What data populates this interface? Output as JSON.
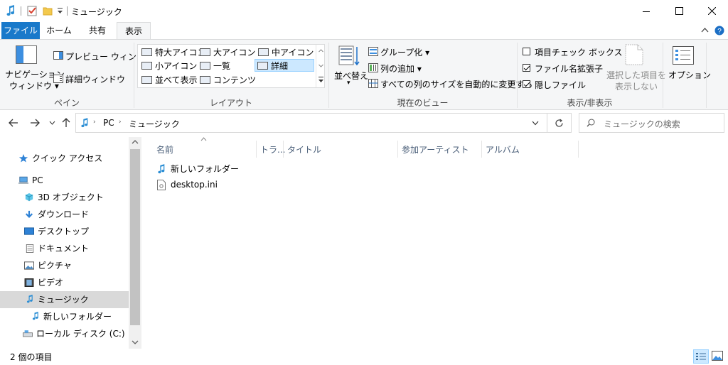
{
  "window": {
    "title": "ミュージック"
  },
  "ribbon_tabs": [
    {
      "label": "ファイル"
    },
    {
      "label": "ホーム"
    },
    {
      "label": "共有"
    },
    {
      "label": "表示"
    }
  ],
  "ribbon": {
    "pane": {
      "nav_pane_line1": "ナビゲーション",
      "nav_pane_line2": "ウィンドウ",
      "preview_pane": "プレビュー ウィンドウ",
      "details_pane": "詳細ウィンドウ",
      "group_label": "ペイン"
    },
    "layout": {
      "items": [
        {
          "label": "特大アイコン"
        },
        {
          "label": "大アイコン"
        },
        {
          "label": "中アイコン"
        },
        {
          "label": "小アイコン"
        },
        {
          "label": "一覧"
        },
        {
          "label": "詳細"
        },
        {
          "label": "並べて表示"
        },
        {
          "label": "コンテンツ"
        }
      ],
      "selected": "詳細",
      "group_label": "レイアウト"
    },
    "current_view": {
      "sort_by": "並べ替え",
      "group_by": "グループ化",
      "add_columns": "列の追加",
      "size_all_columns": "すべての列のサイズを自動的に変更する",
      "group_label": "現在のビュー"
    },
    "show_hide": {
      "item_checkboxes": {
        "label": "項目チェック ボックス",
        "checked": false
      },
      "file_name_extensions": {
        "label": "ファイル名拡張子",
        "checked": true
      },
      "hidden_items": {
        "label": "隠しファイル",
        "checked": true
      },
      "hide_selected_line1": "選択した項目を",
      "hide_selected_line2": "表示しない",
      "group_label": "表示/非表示"
    },
    "options": {
      "label": "オプション"
    }
  },
  "address_bar": {
    "segments": [
      "PC",
      "ミュージック"
    ]
  },
  "search": {
    "placeholder": "ミュージックの検索"
  },
  "nav_pane": {
    "items": [
      {
        "label": "クイック アクセス",
        "icon": "star-icon"
      },
      {
        "label": "PC",
        "icon": "computer-icon"
      },
      {
        "label": "3D オブジェクト",
        "icon": "cube-icon"
      },
      {
        "label": "ダウンロード",
        "icon": "download-icon"
      },
      {
        "label": "デスクトップ",
        "icon": "desktop-icon"
      },
      {
        "label": "ドキュメント",
        "icon": "document-icon"
      },
      {
        "label": "ピクチャ",
        "icon": "picture-icon"
      },
      {
        "label": "ビデオ",
        "icon": "video-icon"
      },
      {
        "label": "ミュージック",
        "icon": "music-icon"
      },
      {
        "label": "新しいフォルダー",
        "icon": "music-icon"
      },
      {
        "label": "ローカル ディスク (C:)",
        "icon": "drive-icon"
      }
    ],
    "selected": "ミュージック"
  },
  "file_list": {
    "columns": [
      "名前",
      "トラ...",
      "タイトル",
      "参加アーティスト",
      "アルバム"
    ],
    "rows": [
      {
        "name": "新しいフォルダー",
        "icon": "music-folder-icon"
      },
      {
        "name": "desktop.ini",
        "icon": "ini-file-icon"
      }
    ]
  },
  "status": {
    "item_count": "2 個の項目"
  },
  "colors": {
    "file_tab": "#1979ca",
    "selection": "#cce8ff",
    "music_accent": "#2a8dd4"
  }
}
